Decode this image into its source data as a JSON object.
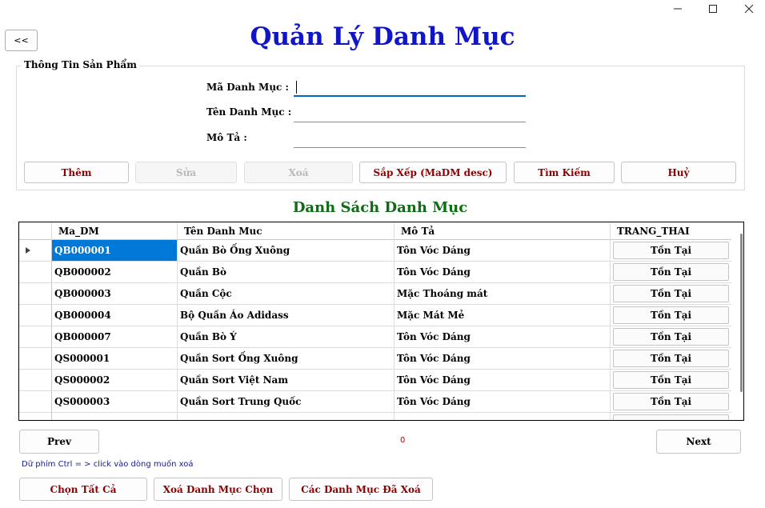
{
  "window": {
    "minimize_icon": "minimize-icon",
    "maximize_icon": "maximize-icon",
    "close_icon": "close-icon"
  },
  "back_label": "<<",
  "title": "Quản Lý Danh Mục",
  "form": {
    "legend": "Thông Tin Sản Phẩm",
    "fields": [
      {
        "label": "Mã Danh Mục :",
        "value": ""
      },
      {
        "label": "Tên Danh Mục :",
        "value": ""
      },
      {
        "label": "Mô Tả :",
        "value": ""
      }
    ]
  },
  "actions": {
    "add": "Thêm",
    "edit": "Sửa",
    "delete": "Xoá",
    "sort": "Sắp Xếp (MaDM desc)",
    "search": "Tìm Kiếm",
    "cancel": "Huỷ"
  },
  "list_title": "Danh Sách Danh Mục",
  "table": {
    "columns": [
      "Ma_DM",
      "Tên Danh Muc",
      "Mô Tả",
      "TRANG_THAI"
    ],
    "rows": [
      {
        "ma": "QB000001",
        "ten": "Quần Bò Ống Xuông",
        "mota": "Tôn Vóc Dáng",
        "trangthai": "Tồn Tại"
      },
      {
        "ma": "QB000002",
        "ten": "Quần Bò",
        "mota": "Tôn Vóc Dáng",
        "trangthai": "Tồn Tại"
      },
      {
        "ma": "QB000003",
        "ten": "Quần Cộc",
        "mota": "Mặc Thoáng mát",
        "trangthai": "Tồn Tại"
      },
      {
        "ma": "QB000004",
        "ten": "Bộ Quần Áo Adidass",
        "mota": "Mặc Mát Mẻ",
        "trangthai": "Tồn Tại"
      },
      {
        "ma": "QB000007",
        "ten": "Quần Bò Ý",
        "mota": "Tôn Vóc Dáng",
        "trangthai": "Tồn Tại"
      },
      {
        "ma": "QS000001",
        "ten": "Quần Sort Ống Xuông",
        "mota": "Tôn Vóc Dáng",
        "trangthai": "Tồn Tại"
      },
      {
        "ma": "QS000002",
        "ten": "Quần Sort Việt Nam",
        "mota": "Tôn Vóc Dáng",
        "trangthai": "Tồn Tại"
      },
      {
        "ma": "QS000003",
        "ten": "Quần Sort Trung Quốc",
        "mota": "Tôn Vóc Dáng",
        "trangthai": "Tồn Tại"
      }
    ]
  },
  "pager": {
    "prev": "Prev",
    "page": "0",
    "next": "Next"
  },
  "hint": "Dữ phím Ctrl = > click vào dòng muốn xoá",
  "bottom": {
    "select_all": "Chọn Tất Cả",
    "delete_selected": "Xoá Danh Mục Chọn",
    "deleted_list": "Các Danh Mục Đã Xoá"
  },
  "colors": {
    "title": "#1015c6",
    "list_title": "#0f6b14",
    "button_text": "#8b0000",
    "selection": "#0078d7"
  }
}
